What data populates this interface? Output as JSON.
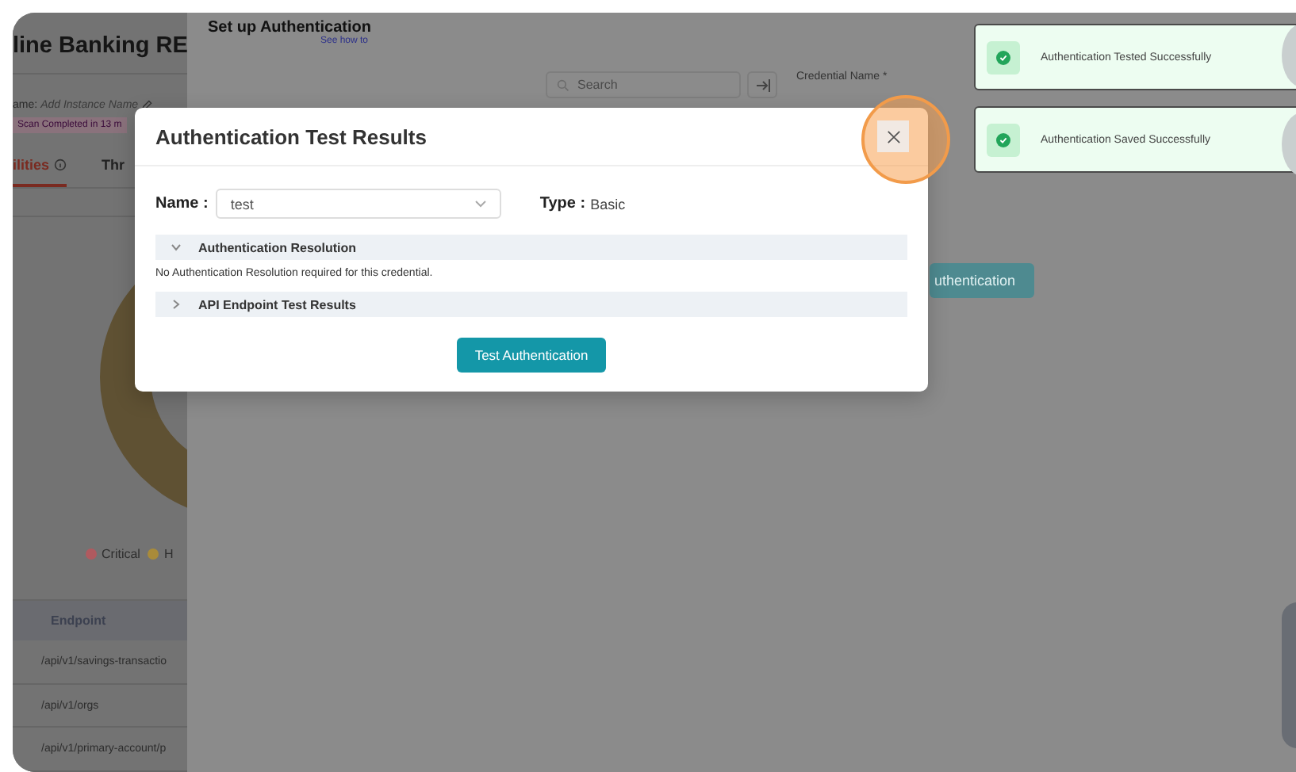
{
  "page": {
    "title": "line Banking RE",
    "instance_label": "ame:",
    "instance_value": "Add Instance Name",
    "scan_badge": "Scan Completed in 13 m",
    "tabs": [
      {
        "label": "ilities",
        "selected": true
      },
      {
        "label": "Thr",
        "selected": false
      }
    ],
    "legend": [
      {
        "label": "Critical",
        "color": "#b05a5f"
      },
      {
        "label": "H",
        "color": "#a98b3a"
      }
    ],
    "table": {
      "columns": [
        "Endpoint"
      ],
      "rows": [
        [
          "/api/v1/savings-transactio"
        ],
        [
          "/api/v1/orgs"
        ],
        [
          "/api/v1/primary-account/p"
        ]
      ]
    }
  },
  "drawer": {
    "title": "Set up Authentication",
    "help_link": "See how to",
    "search": {
      "placeholder": "Search"
    },
    "credential_label": "Credential Name *",
    "action_button": "uthentication"
  },
  "modal": {
    "title": "Authentication Test Results",
    "name_label": "Name :",
    "name_value": "test",
    "type_label": "Type :",
    "type_value": "Basic",
    "sections": [
      {
        "title": "Authentication Resolution",
        "expanded": true,
        "body": "No Authentication Resolution required for this credential."
      },
      {
        "title": "API Endpoint Test Results",
        "expanded": false
      }
    ],
    "button": "Test Authentication"
  },
  "toasts": [
    {
      "message": "Authentication Tested Successfully"
    },
    {
      "message": "Authentication Saved Successfully"
    }
  ]
}
